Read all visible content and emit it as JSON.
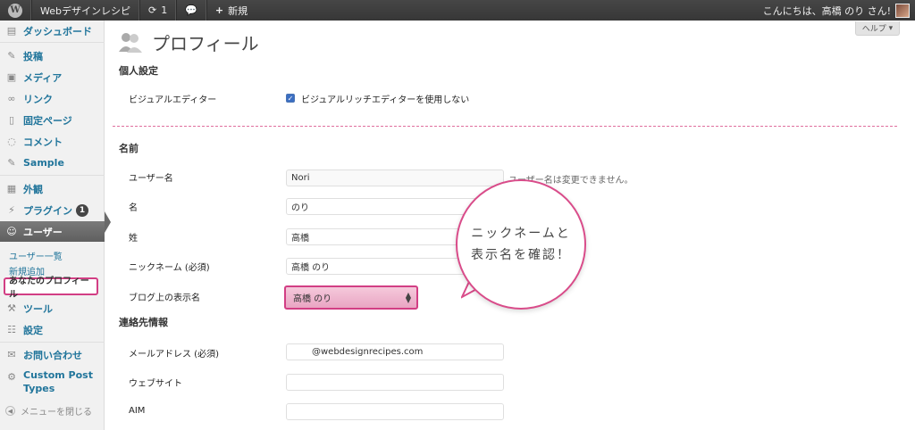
{
  "adminbar": {
    "site_name": "Webデザインレシピ",
    "updates_count": "1",
    "new_label": "新規",
    "greeting": "こんにちは、高橋 のり さん!"
  },
  "sidebar": {
    "dashboard": "ダッシュボード",
    "posts": "投稿",
    "media": "メディア",
    "links": "リンク",
    "pages": "固定ページ",
    "comments": "コメント",
    "sample": "Sample",
    "appearance": "外観",
    "plugins": "プラグイン",
    "plugins_badge": "1",
    "users": "ユーザー",
    "users_sub": [
      "ユーザー一覧",
      "新規追加",
      "あなたのプロフィール"
    ],
    "tools": "ツール",
    "settings": "設定",
    "contact": "お問い合わせ",
    "cpt_line1": "Custom Post",
    "cpt_line2": "Types",
    "collapse": "メニューを閉じる"
  },
  "main": {
    "help": "ヘルプ",
    "title": "プロフィール",
    "personal_heading": "個人設定",
    "visual_editor_label": "ビジュアルエディター",
    "visual_editor_checkbox": "ビジュアルリッチエディターを使用しない",
    "name_heading": "名前",
    "username_label": "ユーザー名",
    "username_value": "Nori",
    "username_note": "ユーザー名は変更できません。",
    "firstname_label": "名",
    "firstname_value": "のり",
    "lastname_label": "姓",
    "lastname_value": "高橋",
    "nickname_label": "ニックネーム (必須)",
    "nickname_value": "高橋 のり",
    "display_label": "ブログ上の表示名",
    "display_value": "高橋 のり",
    "contact_heading": "連絡先情報",
    "email_label": "メールアドレス (必須)",
    "email_value": "@webdesignrecipes.com",
    "website_label": "ウェブサイト",
    "website_value": "",
    "aim_label": "AIM",
    "aim_value": ""
  },
  "callout": {
    "line1": "ニックネームと",
    "line2": "表示名を確認！"
  },
  "colors": {
    "highlight": "#d23e84",
    "link": "#21759b"
  }
}
